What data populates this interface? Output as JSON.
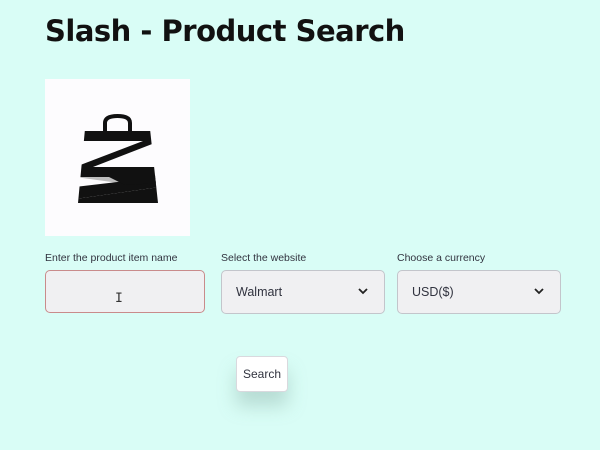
{
  "page": {
    "title": "Slash - Product Search",
    "background_color": "#d9fdf6"
  },
  "logo": {
    "icon": "shopping-bag-icon"
  },
  "form": {
    "product": {
      "label": "Enter the product item name",
      "value": "",
      "placeholder": ""
    },
    "website": {
      "label": "Select the website",
      "selected": "Walmart"
    },
    "currency": {
      "label": "Choose a currency",
      "selected": "USD($)"
    },
    "search_button_label": "Search"
  },
  "colors": {
    "input_border_active": "#c98b8b",
    "input_background": "#f0f0f2",
    "text": "#31333f"
  }
}
